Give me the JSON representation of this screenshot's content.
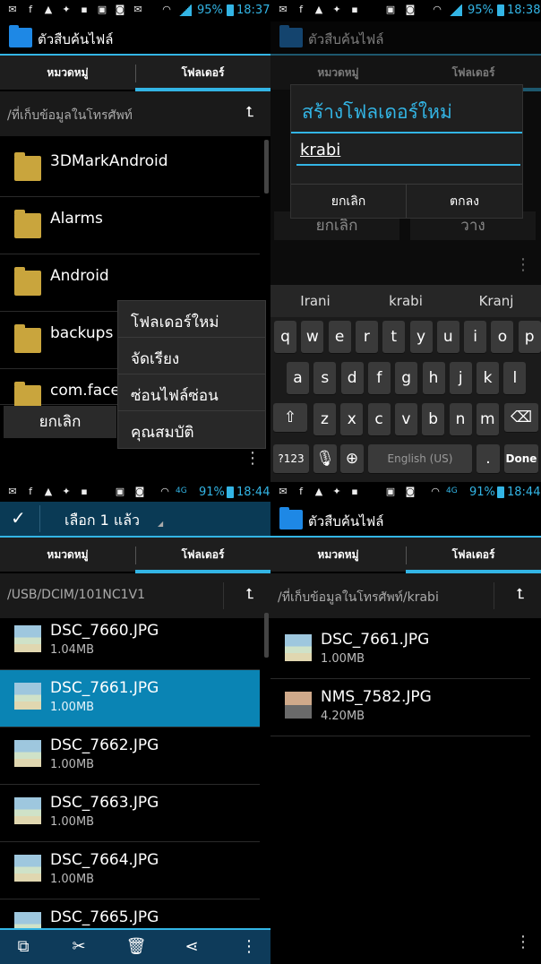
{
  "q1": {
    "status": {
      "pct": "95%",
      "time": "18:37"
    },
    "title": "ตัวสืบค้นไฟล์",
    "tabs": [
      "หมวดหมู่",
      "โฟลเดอร์"
    ],
    "path": "/ที่เก็บข้อมูลในโทรศัพท์",
    "folders": [
      "3DMarkAndroid",
      "Alarms",
      "Android",
      "backups",
      "com.face"
    ],
    "menu": [
      "โฟลเดอร์ใหม่",
      "จัดเรียง",
      "ซ่อนไฟล์ซ่อน",
      "คุณสมบัติ"
    ],
    "cancel": "ยกเลิก"
  },
  "q2": {
    "status": {
      "pct": "95%",
      "time": "18:38"
    },
    "title": "ตัวสืบค้นไฟล์",
    "tabs": [
      "หมวดหมู่",
      "โฟลเดอร์"
    ],
    "dialog": {
      "title": "สร้างโฟลเดอร์ใหม่",
      "value": "krabi",
      "cancel": "ยกเลิก",
      "ok": "ตกลง"
    },
    "behind": {
      "cancel": "ยกเลิก",
      "paste": "วาง"
    },
    "suggestions": [
      "Irani",
      "krabi",
      "Kranj"
    ],
    "rows": [
      [
        "q",
        "w",
        "e",
        "r",
        "t",
        "y",
        "u",
        "i",
        "o",
        "p"
      ],
      [
        "a",
        "s",
        "d",
        "f",
        "g",
        "h",
        "j",
        "k",
        "l"
      ],
      [
        "z",
        "x",
        "c",
        "v",
        "b",
        "n",
        "m"
      ]
    ],
    "sym": "?123",
    "space": "English (US)",
    "period": ".",
    "done": "Done"
  },
  "q3": {
    "status": {
      "pct": "91%",
      "time": "18:44",
      "net": "4G"
    },
    "selected": "เลือก 1 แล้ว",
    "tabs": [
      "หมวดหมู่",
      "โฟลเดอร์"
    ],
    "path": "/USB/DCIM/101NC1V1",
    "files": [
      {
        "name": "DSC_7660.JPG",
        "size": "1.04MB"
      },
      {
        "name": "DSC_7661.JPG",
        "size": "1.00MB"
      },
      {
        "name": "DSC_7662.JPG",
        "size": "1.00MB"
      },
      {
        "name": "DSC_7663.JPG",
        "size": "1.00MB"
      },
      {
        "name": "DSC_7664.JPG",
        "size": "1.00MB"
      },
      {
        "name": "DSC_7665.JPG",
        "size": ""
      }
    ]
  },
  "q4": {
    "status": {
      "pct": "91%",
      "time": "18:44",
      "net": "4G"
    },
    "title": "ตัวสืบค้นไฟล์",
    "tabs": [
      "หมวดหมู่",
      "โฟลเดอร์"
    ],
    "path": "/ที่เก็บข้อมูลในโทรศัพท์/krabi",
    "files": [
      {
        "name": "DSC_7661.JPG",
        "size": "1.00MB"
      },
      {
        "name": "NMS_7582.JPG",
        "size": "4.20MB"
      }
    ]
  },
  "colors": {
    "accent": "#33b5e5",
    "selected": "#0a84b4",
    "folder": "#c9a53d"
  }
}
